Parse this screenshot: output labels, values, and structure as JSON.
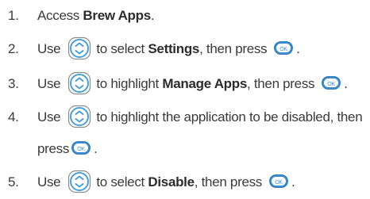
{
  "steps": [
    {
      "number": "1.",
      "before": "Access ",
      "bold": "Brew Apps",
      "after": "."
    },
    {
      "number": "2.",
      "before": "Use",
      "mid1": "to select ",
      "bold": "Settings",
      "mid2": ", then press",
      "after": "."
    },
    {
      "number": "3.",
      "before": "Use",
      "mid1": "to highlight ",
      "bold": "Manage Apps",
      "mid2": ", then press",
      "after": "."
    },
    {
      "number": "4.",
      "before": "Use",
      "mid1": "to highlight the application to be disabled, then",
      "line2_before": "press",
      "after": "."
    },
    {
      "number": "5.",
      "before": "Use",
      "mid1": "to select ",
      "bold": "Disable",
      "mid2": ", then press",
      "after": "."
    }
  ],
  "icons": {
    "nav": "navigation-key-icon",
    "ok": "ok-key-icon",
    "ok_label": "OK"
  },
  "colors": {
    "text": "#3a3a3a",
    "nav_ring": "#4a9fd8",
    "ok_fill": "#3b8fd4"
  }
}
